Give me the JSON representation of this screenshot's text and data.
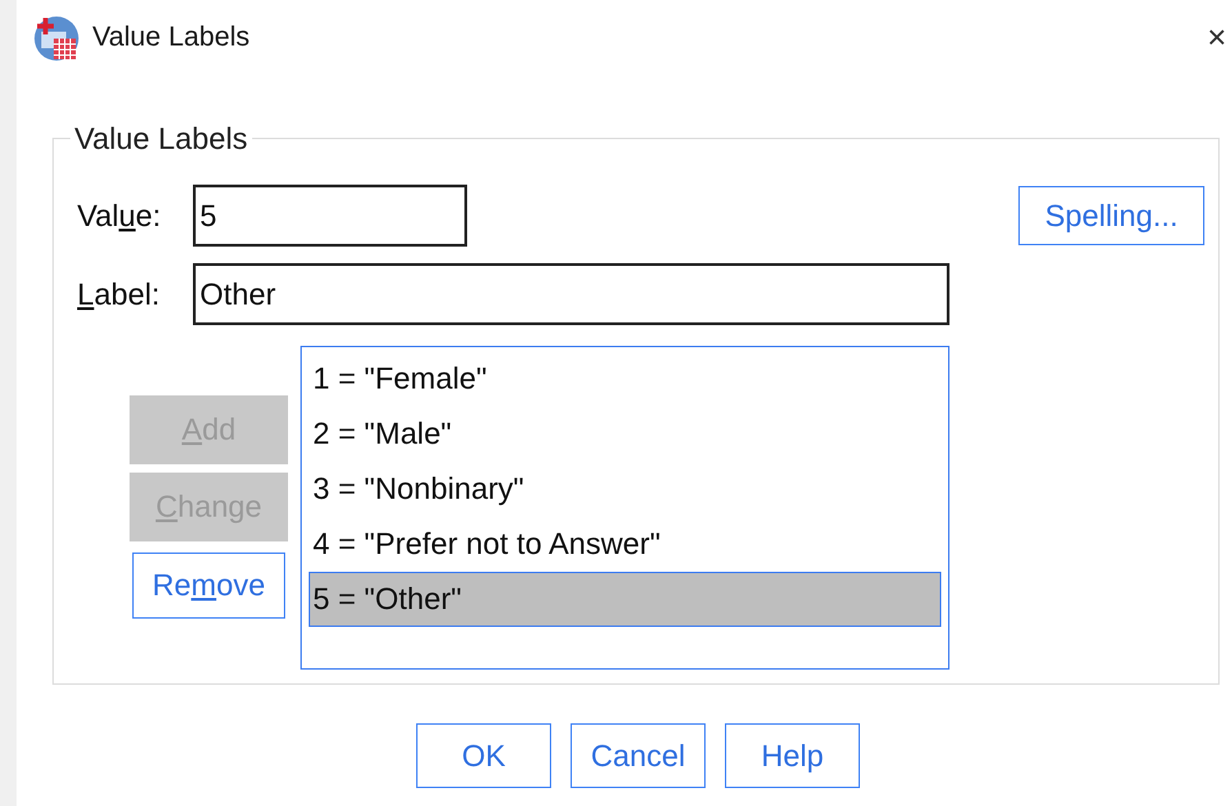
{
  "window": {
    "title": "Value Labels",
    "close": "×"
  },
  "group": {
    "title": "Value Labels",
    "value_field": {
      "label": {
        "pre": "Val",
        "key": "u",
        "post": "e:"
      },
      "value": "5"
    },
    "label_field": {
      "label": {
        "key": "L",
        "post": "abel:"
      },
      "value": "Other"
    },
    "spelling_button": {
      "label": {
        "pre": "Spelling..."
      },
      "disabled": false
    },
    "side_buttons": [
      {
        "label": {
          "key": "A",
          "post": "dd"
        },
        "disabled": true
      },
      {
        "label": {
          "key": "C",
          "post": "hange"
        },
        "disabled": true
      },
      {
        "label": {
          "pre": "Re",
          "key": "m",
          "post": "ove"
        },
        "disabled": false
      }
    ],
    "list": [
      {
        "text": "1 = \"Female\"",
        "selected": false
      },
      {
        "text": "2 = \"Male\"",
        "selected": false
      },
      {
        "text": "3 = \"Nonbinary\"",
        "selected": false
      },
      {
        "text": "4 = \"Prefer not to Answer\"",
        "selected": false
      },
      {
        "text": "5 = \"Other\"",
        "selected": true
      }
    ]
  },
  "buttons": [
    {
      "label": {
        "pre": "OK"
      },
      "disabled": false
    },
    {
      "label": {
        "pre": "Cancel"
      },
      "disabled": false
    },
    {
      "label": {
        "pre": "Help"
      },
      "disabled": false
    }
  ]
}
